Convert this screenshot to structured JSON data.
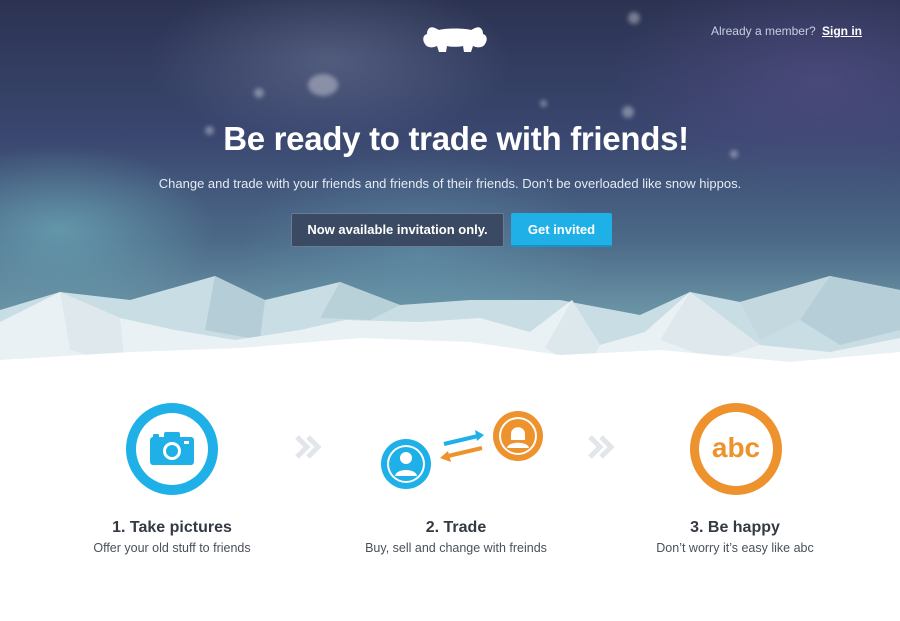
{
  "header": {
    "logo_icon": "hippo-logo-icon",
    "member_prompt": "Already a member?",
    "signin_label": "Sign in"
  },
  "hero": {
    "title": "Be ready to trade with friends!",
    "subtitle": "Change and trade with your friends and friends of their friends. Don’t be overloaded like snow hippos.",
    "note_label": "Now available invitation only.",
    "invite_label": "Get invited"
  },
  "steps": [
    {
      "icon": "camera-icon",
      "title": "1. Take pictures",
      "desc": "Offer your old stuff  to friends"
    },
    {
      "icon": "trade-icon",
      "title": "2. Trade",
      "desc": "Buy, sell and change with freinds"
    },
    {
      "icon": "abc-icon",
      "title": "3. Be happy",
      "desc": "Don’t worry it’s easy like abc",
      "badge_text": "abc"
    }
  ],
  "colors": {
    "blue": "#1fb0e8",
    "orange": "#ee922d",
    "chevron": "#e2e5e9"
  }
}
